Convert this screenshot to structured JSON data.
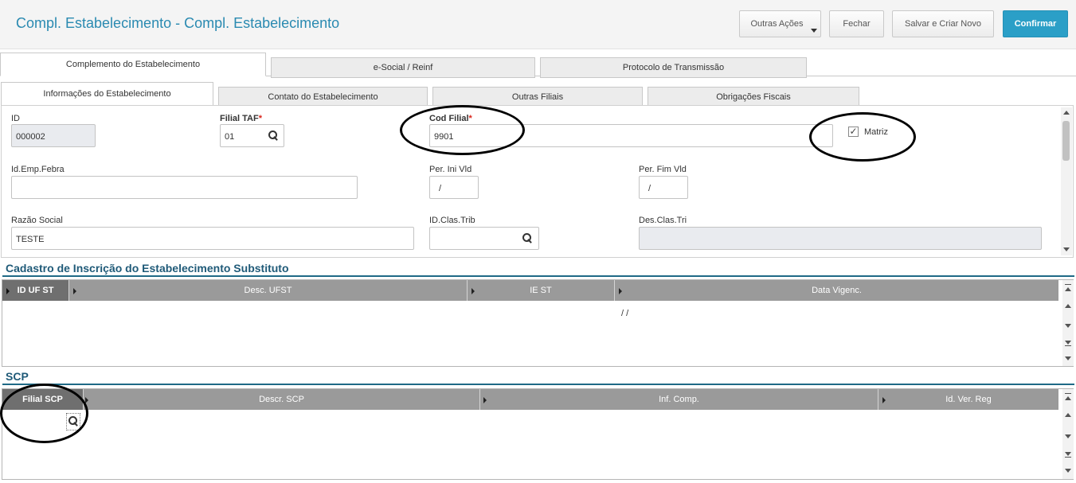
{
  "app": {
    "title": "Compl. Estabelecimento - Compl. Estabelecimento"
  },
  "toolbar": {
    "outras_acoes": "Outras Ações",
    "fechar": "Fechar",
    "salvar_criar": "Salvar e Criar Novo",
    "confirmar": "Confirmar"
  },
  "tabs_main": [
    {
      "label": "Complemento do Estabelecimento",
      "active": true
    },
    {
      "label": "e-Social / Reinf",
      "active": false
    },
    {
      "label": "Protocolo de Transmissão",
      "active": false
    }
  ],
  "tabs_sub": [
    {
      "label": "Informações do Estabelecimento",
      "active": true
    },
    {
      "label": "Contato do Estabelecimento",
      "active": false
    },
    {
      "label": "Outras Filiais",
      "active": false
    },
    {
      "label": "Obrigações Fiscais",
      "active": false
    }
  ],
  "form": {
    "id": {
      "label": "ID",
      "value": "000002"
    },
    "filial_taf": {
      "label": "Filial TAF",
      "required": "*",
      "value": "01"
    },
    "cod_filial": {
      "label": "Cod Filial",
      "required": "*",
      "value": "9901"
    },
    "matriz": {
      "label": "Matriz",
      "checked": true,
      "checkmark": "✓"
    },
    "id_emp_febra": {
      "label": "Id.Emp.Febra",
      "value": ""
    },
    "per_ini_vld": {
      "label": "Per. Ini Vld",
      "value": "/"
    },
    "per_fim_vld": {
      "label": "Per. Fim Vld",
      "value": "/"
    },
    "razao_social": {
      "label": "Razão Social",
      "value": "TESTE"
    },
    "id_clas_trib": {
      "label": "ID.Clas.Trib",
      "value": ""
    },
    "des_clas_tri": {
      "label": "Des.Clas.Tri",
      "value": ""
    }
  },
  "section_substituto": {
    "title": "Cadastro de Inscrição do Estabelecimento Substituto",
    "columns": [
      "ID UF ST",
      "Desc. UFST",
      "IE ST",
      "Data Vigenc."
    ],
    "row": {
      "data_vigenc": "/ /"
    }
  },
  "section_scp": {
    "title": "SCP",
    "columns": [
      "Filial SCP",
      "Descr. SCP",
      "Inf. Comp.",
      "Id. Ver. Reg"
    ]
  },
  "colors": {
    "title": "#2a8ab1",
    "primary_button": "#2b9fc7",
    "section_title": "#1f5a78",
    "grid_header": "#9a9a9a",
    "grid_header_selected": "#6f6f6f",
    "required": "#d9261c",
    "readonly_field": "#e9ebef"
  },
  "icons": {
    "search": "search-icon",
    "dropdown": "chevron-down-icon",
    "checkbox": "check-icon"
  }
}
